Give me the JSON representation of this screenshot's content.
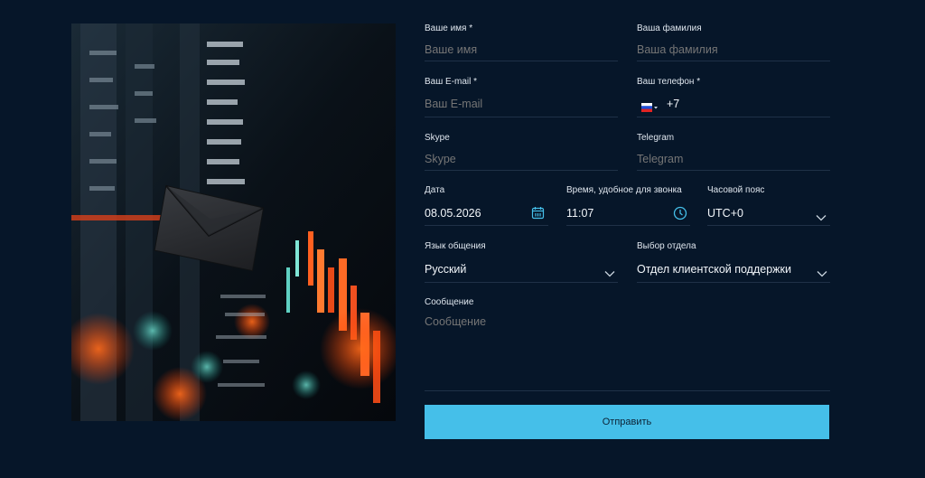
{
  "form": {
    "first_name": {
      "label": "Ваше имя *",
      "placeholder": "Ваше имя"
    },
    "last_name": {
      "label": "Ваша фамилия",
      "placeholder": "Ваша фамилия"
    },
    "email": {
      "label": "Ваш E-mail *",
      "placeholder": "Ваш E-mail"
    },
    "phone": {
      "label": "Ваш телефон *",
      "value": "+7"
    },
    "skype": {
      "label": "Skype",
      "placeholder": "Skype"
    },
    "telegram": {
      "label": "Telegram",
      "placeholder": "Telegram"
    },
    "date": {
      "label": "Дата",
      "value": "08.05.2026"
    },
    "time": {
      "label": "Время, удобное для звонка",
      "value": "11:07"
    },
    "timezone": {
      "label": "Часовой пояс",
      "value": "UTC+0"
    },
    "language": {
      "label": "Язык общения",
      "value": "Русский"
    },
    "department": {
      "label": "Выбор отдела",
      "value": "Отдел клиентской поддержки"
    },
    "message": {
      "label": "Сообщение",
      "placeholder": "Сообщение"
    },
    "submit_label": "Отправить"
  },
  "icons": {
    "calendar": "calendar-icon",
    "clock": "clock-icon",
    "chevron": "chevron-down-icon",
    "flag": "russia-flag-icon"
  },
  "colors": {
    "background": "#061629",
    "accent": "#45bfe9",
    "divider": "#1f3147",
    "placeholder": "#6f8193"
  }
}
